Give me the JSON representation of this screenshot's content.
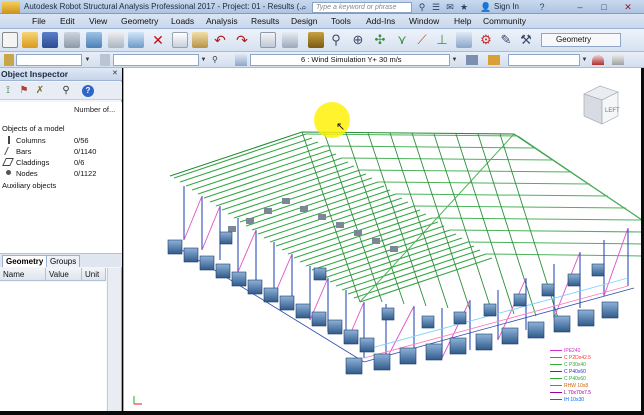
{
  "titlebar": {
    "title": "Autodesk Robot Structural Analysis Professional 2017 - Project: 01 - Results (...",
    "search_placeholder": "Type a keyword or phrase",
    "sign_in": "Sign In"
  },
  "menu": {
    "items": [
      "File",
      "Edit",
      "View",
      "Geometry",
      "Loads",
      "Analysis",
      "Results",
      "Design",
      "Tools",
      "Add-Ins",
      "Window",
      "Help",
      "Community"
    ]
  },
  "toolbar1": {
    "geometry_dropdown": "Geometry"
  },
  "toolbar2": {
    "load_case": "6 : Wind Simulation Y+ 30 m/s"
  },
  "object_inspector": {
    "title": "Object Inspector",
    "col_number": "Number of...",
    "root": "Objects of a model",
    "nodes": [
      {
        "label": "Columns",
        "count": "0/56"
      },
      {
        "label": "Bars",
        "count": "0/1140"
      },
      {
        "label": "Claddings",
        "count": "0/6"
      },
      {
        "label": "Nodes",
        "count": "0/1122"
      }
    ],
    "auxiliary": "Auxiliary objects",
    "tabs": [
      "Geometry",
      "Groups"
    ],
    "prop_cols": [
      "Name",
      "Value",
      "Unit"
    ]
  },
  "viewcube": {
    "face_label": "LEFT"
  },
  "legend": {
    "colors": [
      "#cc33cc",
      "#ff3333",
      "#33aa33",
      "#3333cc",
      "#990099",
      "#cc6600",
      "#0066ff"
    ],
    "items": [
      "IPE240",
      "C P2Dx42.5",
      "C P30x40",
      "C P40x60",
      "C P40x60",
      "RHW 10x8",
      "L 70x70x7.5",
      "IH 10x30"
    ]
  }
}
